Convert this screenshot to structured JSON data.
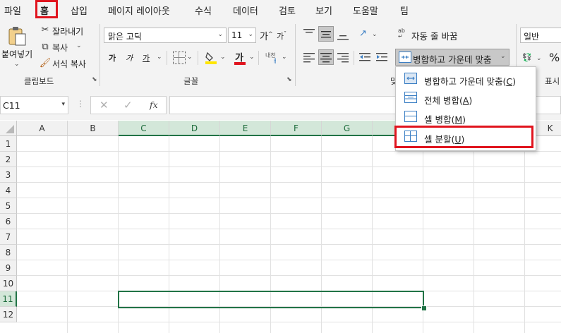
{
  "menu": {
    "tabs": [
      "파일",
      "홈",
      "삽입",
      "페이지 레이아웃",
      "수식",
      "데이터",
      "검토",
      "보기",
      "도움말",
      "팀"
    ],
    "active_tab": "홈"
  },
  "clipboard": {
    "paste_label": "붙여넣기",
    "cut_label": "잘라내기",
    "copy_label": "복사",
    "format_painter_label": "서식 복사",
    "group_label": "클립보드"
  },
  "font": {
    "font_name": "맑은 고딕",
    "font_size": "11",
    "grow_label": "가",
    "shrink_label": "가",
    "bold": "가",
    "italic": "가",
    "underline": "가",
    "color_letter": "가",
    "phonetic_label": "내천",
    "group_label": "글꼴"
  },
  "alignment": {
    "wrap_label": "자동 줄 바꿈",
    "merge_label": "병합하고 가운데 맞춤",
    "group_label_partial": "맞"
  },
  "number": {
    "format": "일반",
    "group_label_partial": "표시"
  },
  "colors": {
    "accent_green": "#217346",
    "highlight_red": "#e0141e",
    "fill_yellow": "#ffe600",
    "font_red": "#e0141e"
  },
  "formula_bar": {
    "name_box": "C11",
    "fx": "fx"
  },
  "grid": {
    "columns": [
      "A",
      "B",
      "C",
      "D",
      "E",
      "F",
      "G",
      "",
      "",
      "K"
    ],
    "rows": [
      "1",
      "2",
      "3",
      "4",
      "5",
      "6",
      "7",
      "8",
      "9",
      "10",
      "11",
      "12"
    ]
  },
  "merge_menu": {
    "items": [
      {
        "label": "병합하고 가운데 맞춤(",
        "key": "C",
        "end": ")"
      },
      {
        "label": "전체 병합(",
        "key": "A",
        "end": ")"
      },
      {
        "label": "셀 병합(",
        "key": "M",
        "end": ")"
      },
      {
        "label": "셀 분할(",
        "key": "U",
        "end": ")"
      }
    ]
  }
}
